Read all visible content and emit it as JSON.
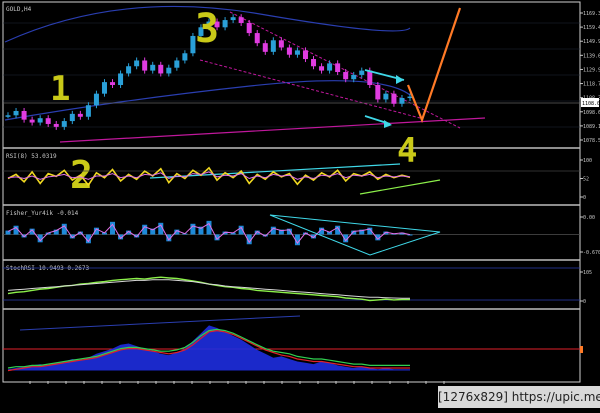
{
  "colors": {
    "background": "#000000",
    "frame": "#cfcfcf",
    "divider": "#bdbdbd",
    "grid": "#1e2a3a",
    "text": "#c8c8c8",
    "bull_candle": "#2aa0d8",
    "bear_candle": "#e03ce0",
    "channel_blue": "#2a3eb0",
    "channel_magenta": "#c0189c",
    "cyan_arrow": "#3fd8e8",
    "projection": "#ff7a26",
    "wave_label": "#c9c918",
    "rsi_main": "#f0d820",
    "rsi_secondary": "#e070e8",
    "fisher_bar": "#1e8ad8",
    "fisher_line": "#e070e8",
    "stoch_green": "#8cf04a",
    "stoch_white": "#d8d8d8",
    "stoch_magenta": "#d060e0",
    "band_fill": "#1e2ee0",
    "ma_red": "#e0202a",
    "ma_green": "#30d050",
    "price_tag": "#ffffff"
  },
  "watermark": "[1276x829] https://upic.me/",
  "chart_data": [
    {
      "type": "line",
      "pane": "price",
      "title": "GOLD,H4",
      "series": [
        {
          "values": [
            1097,
            1100,
            1094,
            1092,
            1095,
            1091,
            1089,
            1093,
            1098,
            1096,
            1104,
            1112,
            1120,
            1118,
            1126,
            1131,
            1135,
            1128,
            1132,
            1126,
            1130,
            1135,
            1140,
            1152,
            1158,
            1162,
            1158,
            1163,
            1165,
            1161,
            1154,
            1147,
            1141,
            1149,
            1144,
            1139,
            1142,
            1136,
            1131,
            1128,
            1133,
            1127,
            1122,
            1125,
            1128,
            1118,
            1108,
            1112,
            1105,
            1109,
            1110
          ]
        }
      ],
      "yaxis_ticks": [
        "1169.30",
        "1159.40",
        "1149.90",
        "1139.60",
        "1129.90",
        "1118.70",
        "1108.30",
        "1098.60",
        "1089.10",
        "1078.50"
      ],
      "current_price": "1108.01",
      "ylim": [
        1078.5,
        1169.3
      ],
      "wave_labels": [
        "1",
        "2",
        "3",
        "4"
      ]
    },
    {
      "type": "line",
      "pane": "rsi",
      "title": "RSI(8) 53.0319",
      "series": [
        {
          "values": [
            50,
            60,
            42,
            66,
            38,
            62,
            55,
            70,
            46,
            58,
            34,
            64,
            52,
            72,
            44,
            60,
            48,
            68,
            56,
            74,
            40,
            62,
            50,
            70,
            58,
            76,
            46,
            64,
            52,
            68,
            38,
            60,
            48,
            66,
            54,
            62,
            36,
            58,
            46,
            64,
            54,
            70,
            44,
            62,
            56,
            66,
            48,
            60,
            52,
            58,
            53
          ]
        },
        {
          "values": [
            52,
            54,
            50,
            56,
            48,
            54,
            56,
            60,
            52,
            54,
            48,
            56,
            56,
            62,
            52,
            56,
            52,
            60,
            58,
            64,
            50,
            56,
            54,
            62,
            60,
            66,
            54,
            58,
            56,
            62,
            50,
            56,
            52,
            60,
            56,
            58,
            48,
            54,
            50,
            58,
            56,
            62,
            52,
            58,
            56,
            60,
            52,
            56,
            54,
            56,
            54
          ]
        }
      ],
      "yaxis_ticks": [
        "100",
        "52",
        "0"
      ],
      "ylim": [
        0,
        100
      ]
    },
    {
      "type": "bar",
      "pane": "fisher",
      "title": "Fisher_Yur4ik -0.014",
      "series": [
        {
          "values": [
            0.4,
            0.9,
            -0.3,
            0.6,
            -0.8,
            0.2,
            0.5,
            1.1,
            -0.4,
            0.3,
            -0.9,
            0.7,
            0.2,
            1.3,
            -0.5,
            0.4,
            -0.3,
            1.0,
            0.6,
            1.2,
            -0.7,
            0.5,
            0.1,
            1.1,
            0.8,
            1.4,
            -0.6,
            0.3,
            0.2,
            0.9,
            -1.0,
            0.4,
            -0.2,
            0.8,
            0.5,
            0.6,
            -1.1,
            0.2,
            -0.4,
            0.7,
            0.3,
            0.9,
            -0.8,
            0.4,
            0.5,
            0.7,
            -0.6,
            0.3,
            0.1,
            0.2,
            -0.014
          ]
        }
      ],
      "yaxis_ticks": [
        "0.00",
        "-0.670"
      ],
      "ylim": [
        -2,
        2
      ]
    },
    {
      "type": "line",
      "pane": "stochrsi",
      "title": "StochRSI 10.9493 0.2673",
      "series": [
        {
          "values": [
            30,
            34,
            36,
            40,
            44,
            46,
            50,
            54,
            56,
            60,
            62,
            66,
            68,
            72,
            74,
            76,
            78,
            76,
            80,
            82,
            80,
            78,
            74,
            70,
            66,
            60,
            56,
            52,
            50,
            46,
            44,
            40,
            38,
            36,
            34,
            32,
            30,
            28,
            26,
            24,
            22,
            20,
            16,
            14,
            12,
            8,
            10,
            12,
            10,
            11,
            11
          ]
        },
        {
          "values": [
            40,
            42,
            44,
            46,
            48,
            50,
            52,
            54,
            56,
            58,
            60,
            62,
            64,
            66,
            68,
            70,
            72,
            72,
            74,
            74,
            74,
            72,
            70,
            68,
            64,
            60,
            58,
            54,
            52,
            50,
            48,
            46,
            44,
            42,
            40,
            38,
            36,
            34,
            32,
            30,
            28,
            26,
            24,
            22,
            20,
            18,
            18,
            17,
            16,
            15,
            15
          ]
        }
      ],
      "yaxis_ticks": [
        "105",
        "0"
      ],
      "ylim": [
        0,
        105
      ]
    },
    {
      "type": "area",
      "pane": "bands",
      "title": "",
      "series": [
        {
          "values": [
            2,
            4,
            6,
            8,
            10,
            8,
            12,
            14,
            18,
            16,
            20,
            26,
            30,
            34,
            40,
            42,
            38,
            34,
            30,
            26,
            24,
            28,
            34,
            46,
            58,
            70,
            66,
            60,
            54,
            48,
            40,
            32,
            26,
            20,
            22,
            18,
            14,
            12,
            10,
            14,
            12,
            8,
            6,
            4,
            6,
            4,
            2,
            4,
            2,
            2,
            2
          ]
        },
        {
          "values": [
            0,
            2,
            4,
            6,
            6,
            8,
            10,
            12,
            14,
            16,
            18,
            20,
            24,
            28,
            32,
            34,
            34,
            32,
            30,
            28,
            26,
            28,
            32,
            40,
            50,
            60,
            62,
            60,
            56,
            50,
            44,
            38,
            32,
            28,
            24,
            22,
            18,
            16,
            14,
            14,
            12,
            10,
            8,
            6,
            6,
            4,
            4,
            4,
            4,
            4,
            4
          ]
        },
        {
          "values": [
            4,
            6,
            6,
            8,
            8,
            10,
            12,
            14,
            16,
            18,
            20,
            22,
            26,
            30,
            34,
            36,
            36,
            34,
            32,
            30,
            30,
            32,
            36,
            44,
            54,
            62,
            64,
            62,
            58,
            52,
            46,
            40,
            34,
            30,
            28,
            26,
            22,
            20,
            18,
            18,
            16,
            14,
            12,
            10,
            10,
            8,
            8,
            8,
            8,
            8,
            8
          ]
        }
      ],
      "yaxis_ticks": [],
      "ylim": [
        -10,
        80
      ]
    }
  ]
}
